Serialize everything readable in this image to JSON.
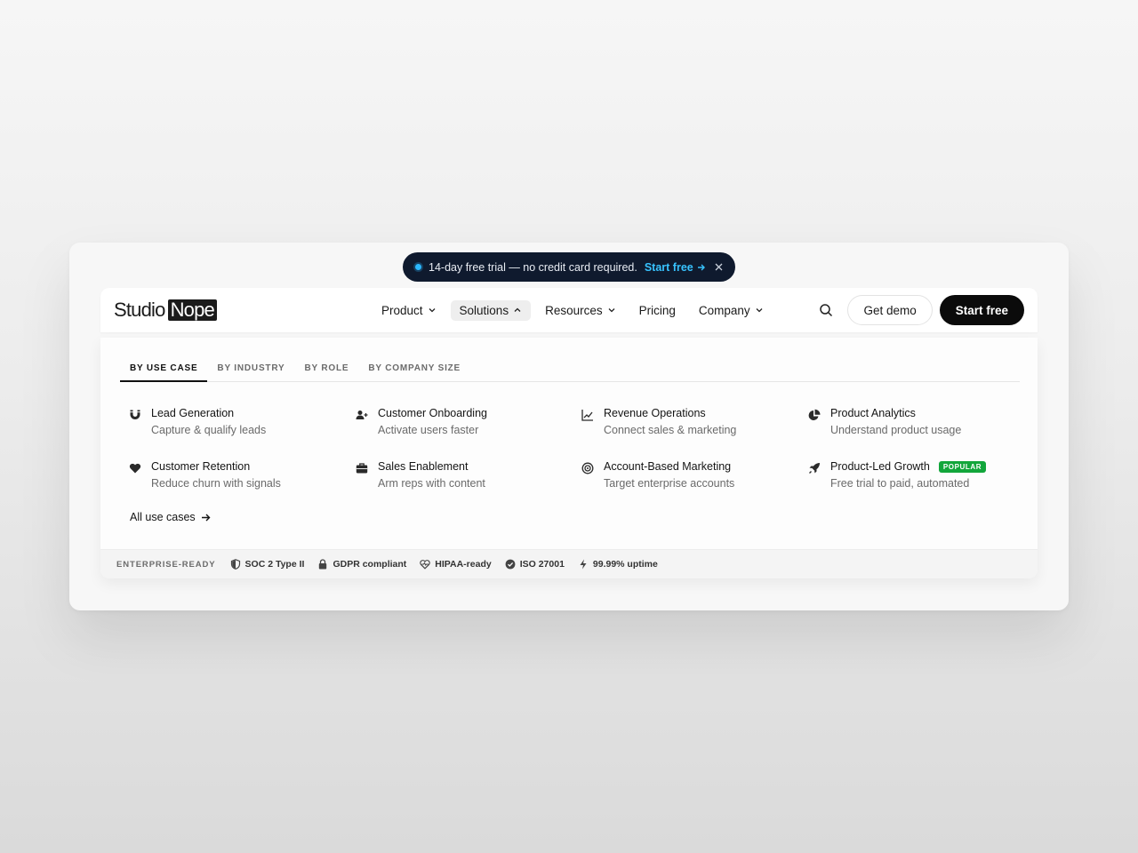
{
  "announcement": {
    "message": "14-day free trial — no credit card required.",
    "cta": "Start free"
  },
  "brand": {
    "word1": "Studio",
    "word2": "Nope"
  },
  "nav": {
    "items": [
      {
        "label": "Product",
        "has_caret": true
      },
      {
        "label": "Solutions",
        "has_caret": true,
        "active": true
      },
      {
        "label": "Resources",
        "has_caret": true
      },
      {
        "label": "Pricing",
        "has_caret": false
      },
      {
        "label": "Company",
        "has_caret": true
      }
    ],
    "get_demo": "Get demo",
    "start_free": "Start free"
  },
  "tabs": [
    "BY USE CASE",
    "BY INDUSTRY",
    "BY ROLE",
    "BY COMPANY SIZE"
  ],
  "use_cases": [
    {
      "title": "Lead Generation",
      "desc": "Capture & qualify leads",
      "icon": "magnet-icon"
    },
    {
      "title": "Customer Onboarding",
      "desc": "Activate users faster",
      "icon": "user-plus-icon"
    },
    {
      "title": "Revenue Operations",
      "desc": "Connect sales & marketing",
      "icon": "chart-line-icon"
    },
    {
      "title": "Product Analytics",
      "desc": "Understand product usage",
      "icon": "pie-chart-icon"
    },
    {
      "title": "Customer Retention",
      "desc": "Reduce churn with signals",
      "icon": "heart-icon"
    },
    {
      "title": "Sales Enablement",
      "desc": "Arm reps with content",
      "icon": "briefcase-icon"
    },
    {
      "title": "Account-Based Marketing",
      "desc": "Target enterprise accounts",
      "icon": "target-icon"
    },
    {
      "title": "Product-Led Growth",
      "desc": "Free trial to paid, automated",
      "icon": "rocket-icon",
      "badge": "POPULAR"
    }
  ],
  "all_link": "All use cases",
  "footer": {
    "label": "ENTERPRISE-READY",
    "certs": [
      {
        "label": "SOC 2 Type II",
        "icon": "shield-icon"
      },
      {
        "label": "GDPR compliant",
        "icon": "lock-icon"
      },
      {
        "label": "HIPAA-ready",
        "icon": "heart-pulse-icon"
      },
      {
        "label": "ISO 27001",
        "icon": "check-badge-icon"
      },
      {
        "label": "99.99% uptime",
        "icon": "bolt-icon"
      }
    ]
  },
  "colors": {
    "accent": "#38c3ff",
    "badge": "#12a63b",
    "dark": "#0b0b0b",
    "announce_bg": "#0f1a2e"
  }
}
